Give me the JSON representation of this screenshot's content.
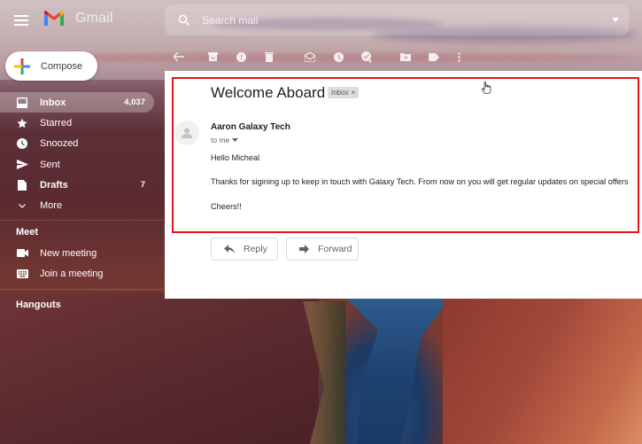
{
  "app": {
    "name": "Gmail",
    "brand_colors": {
      "red": "#ea4335",
      "blue": "#4285f4",
      "yellow": "#fbbc04",
      "green": "#34a853"
    }
  },
  "header": {
    "menu_icon": "hamburger-menu-icon",
    "search": {
      "placeholder": "Search mail",
      "value": "",
      "icon": "search-icon",
      "options_icon": "caret-down-icon"
    }
  },
  "toolbar": {
    "icons": [
      "back-arrow-icon",
      "archive-icon",
      "report-spam-icon",
      "delete-icon",
      "mark-unread-icon",
      "snooze-icon",
      "add-to-tasks-icon",
      "move-to-icon",
      "label-icon",
      "more-vertical-icon"
    ]
  },
  "sidebar": {
    "compose_label": "Compose",
    "items": [
      {
        "label": "Inbox",
        "count": "4,037",
        "icon": "inbox-icon",
        "active": true
      },
      {
        "label": "Starred",
        "count": "",
        "icon": "star-icon"
      },
      {
        "label": "Snoozed",
        "count": "",
        "icon": "clock-icon"
      },
      {
        "label": "Sent",
        "count": "",
        "icon": "send-icon"
      },
      {
        "label": "Drafts",
        "count": "7",
        "icon": "draft-icon"
      },
      {
        "label": "More",
        "count": "",
        "icon": "chevron-down-icon"
      }
    ],
    "meet": {
      "title": "Meet",
      "items": [
        {
          "label": "New meeting",
          "icon": "video-camera-icon"
        },
        {
          "label": "Join a meeting",
          "icon": "keyboard-icon"
        }
      ]
    },
    "hangouts_title": "Hangouts"
  },
  "email": {
    "subject": "Welcome Aboard",
    "label_chip": "Inbox",
    "label_chip_remove": "×",
    "sender": "Aaron Galaxy Tech",
    "recipient": "to me",
    "body": {
      "greeting": "Hello Micheal",
      "paragraph": "Thanks for sigining up to keep in touch with Galaxy Tech. From now on you will get regular updates on special offers",
      "signoff": "Cheers!!"
    },
    "actions": {
      "reply": "Reply",
      "forward": "Forward"
    },
    "highlight_color": "#e8141a"
  }
}
